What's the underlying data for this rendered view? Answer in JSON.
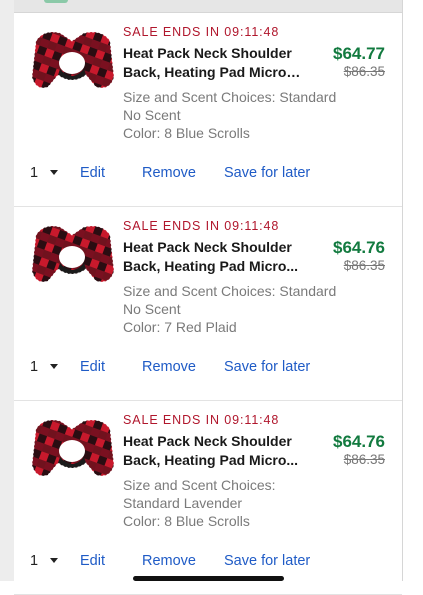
{
  "cart": {
    "items": [
      {
        "sale": "SALE ENDS IN 09:11:48",
        "title_l1": "Heat Pack Neck Shoulder",
        "title_l2": "Back, Heating Pad Microw...",
        "price": "$64.77",
        "old_price": "$86.35",
        "attr1": "Size and Scent Choices: Standard",
        "attr2": "No Scent",
        "attr3": "Color: 8 Blue Scrolls",
        "qty": "1",
        "edit": "Edit",
        "remove": "Remove",
        "save": "Save for later"
      },
      {
        "sale": "SALE ENDS IN 09:11:48",
        "title_l1": "Heat Pack Neck Shoulder",
        "title_l2": "Back, Heating Pad Micro...",
        "price": "$64.76",
        "old_price": "$86.35",
        "attr1": "Size and Scent Choices: Standard",
        "attr2": "No Scent",
        "attr3": "Color: 7 Red Plaid",
        "qty": "1",
        "edit": "Edit",
        "remove": "Remove",
        "save": "Save for later"
      },
      {
        "sale": "SALE ENDS IN 09:11:48",
        "title_l1": "Heat Pack Neck Shoulder",
        "title_l2": "Back, Heating Pad Micro...",
        "price": "$64.76",
        "old_price": "$86.35",
        "attr1": "Size and Scent Choices:",
        "attr2": "Standard Lavender",
        "attr3": "Color: 8 Blue Scrolls",
        "qty": "1",
        "edit": "Edit",
        "remove": "Remove",
        "save": "Save for later"
      }
    ]
  },
  "colors": {
    "sale": "#b0162c",
    "price": "#127a3f",
    "link": "#1f5bc6"
  },
  "icons": {
    "thumb": "red-plaid-neck-wrap",
    "qty": "caret-down-icon"
  }
}
